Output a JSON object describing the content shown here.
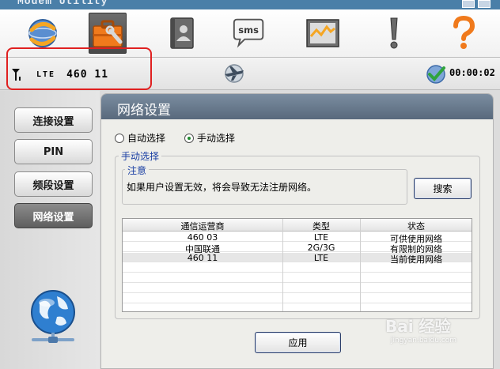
{
  "window": {
    "title": "Modem Utility"
  },
  "toolbar": {
    "items": [
      {
        "name": "connect",
        "icon": "connection-icon"
      },
      {
        "name": "settings",
        "icon": "toolbox-icon",
        "active": true
      },
      {
        "name": "contacts",
        "icon": "contacts-icon"
      },
      {
        "name": "sms",
        "icon": "sms-icon",
        "label": "sms"
      },
      {
        "name": "statistics",
        "icon": "chart-icon"
      },
      {
        "name": "alert",
        "icon": "exclamation-icon"
      },
      {
        "name": "help",
        "icon": "help-icon"
      }
    ]
  },
  "status": {
    "rat": "LTE",
    "plmn": "460 11",
    "timer": "00:00:02"
  },
  "sidebar": {
    "items": [
      {
        "label": "连接设置"
      },
      {
        "label": "PIN"
      },
      {
        "label": "频段设置"
      },
      {
        "label": "网络设置",
        "active": true
      }
    ]
  },
  "panel": {
    "title": "网络设置",
    "radio_auto": "自动选择",
    "radio_manual": "手动选择",
    "manual_legend": "手动选择",
    "note_legend": "注意",
    "note_text": "如果用户设置无效，将会导致无法注册网络。",
    "search_label": "搜索",
    "apply_label": "应用"
  },
  "table": {
    "columns": [
      "通信运营商",
      "类型",
      "状态"
    ],
    "rows": [
      {
        "operator": "460 03",
        "type": "LTE",
        "status": "可供使用网络"
      },
      {
        "operator": "中国联通",
        "type": "2G/3G",
        "status": "有限制的网络"
      },
      {
        "operator": "460 11",
        "type": "LTE",
        "status": "当前使用网络"
      }
    ]
  },
  "watermark": {
    "brand": "Bai 经验",
    "url": "jingyan.baidu.com"
  },
  "colors": {
    "highlight": "#e02020",
    "panel_header": "#6a7c90",
    "legend_text": "#1a3fa3"
  }
}
